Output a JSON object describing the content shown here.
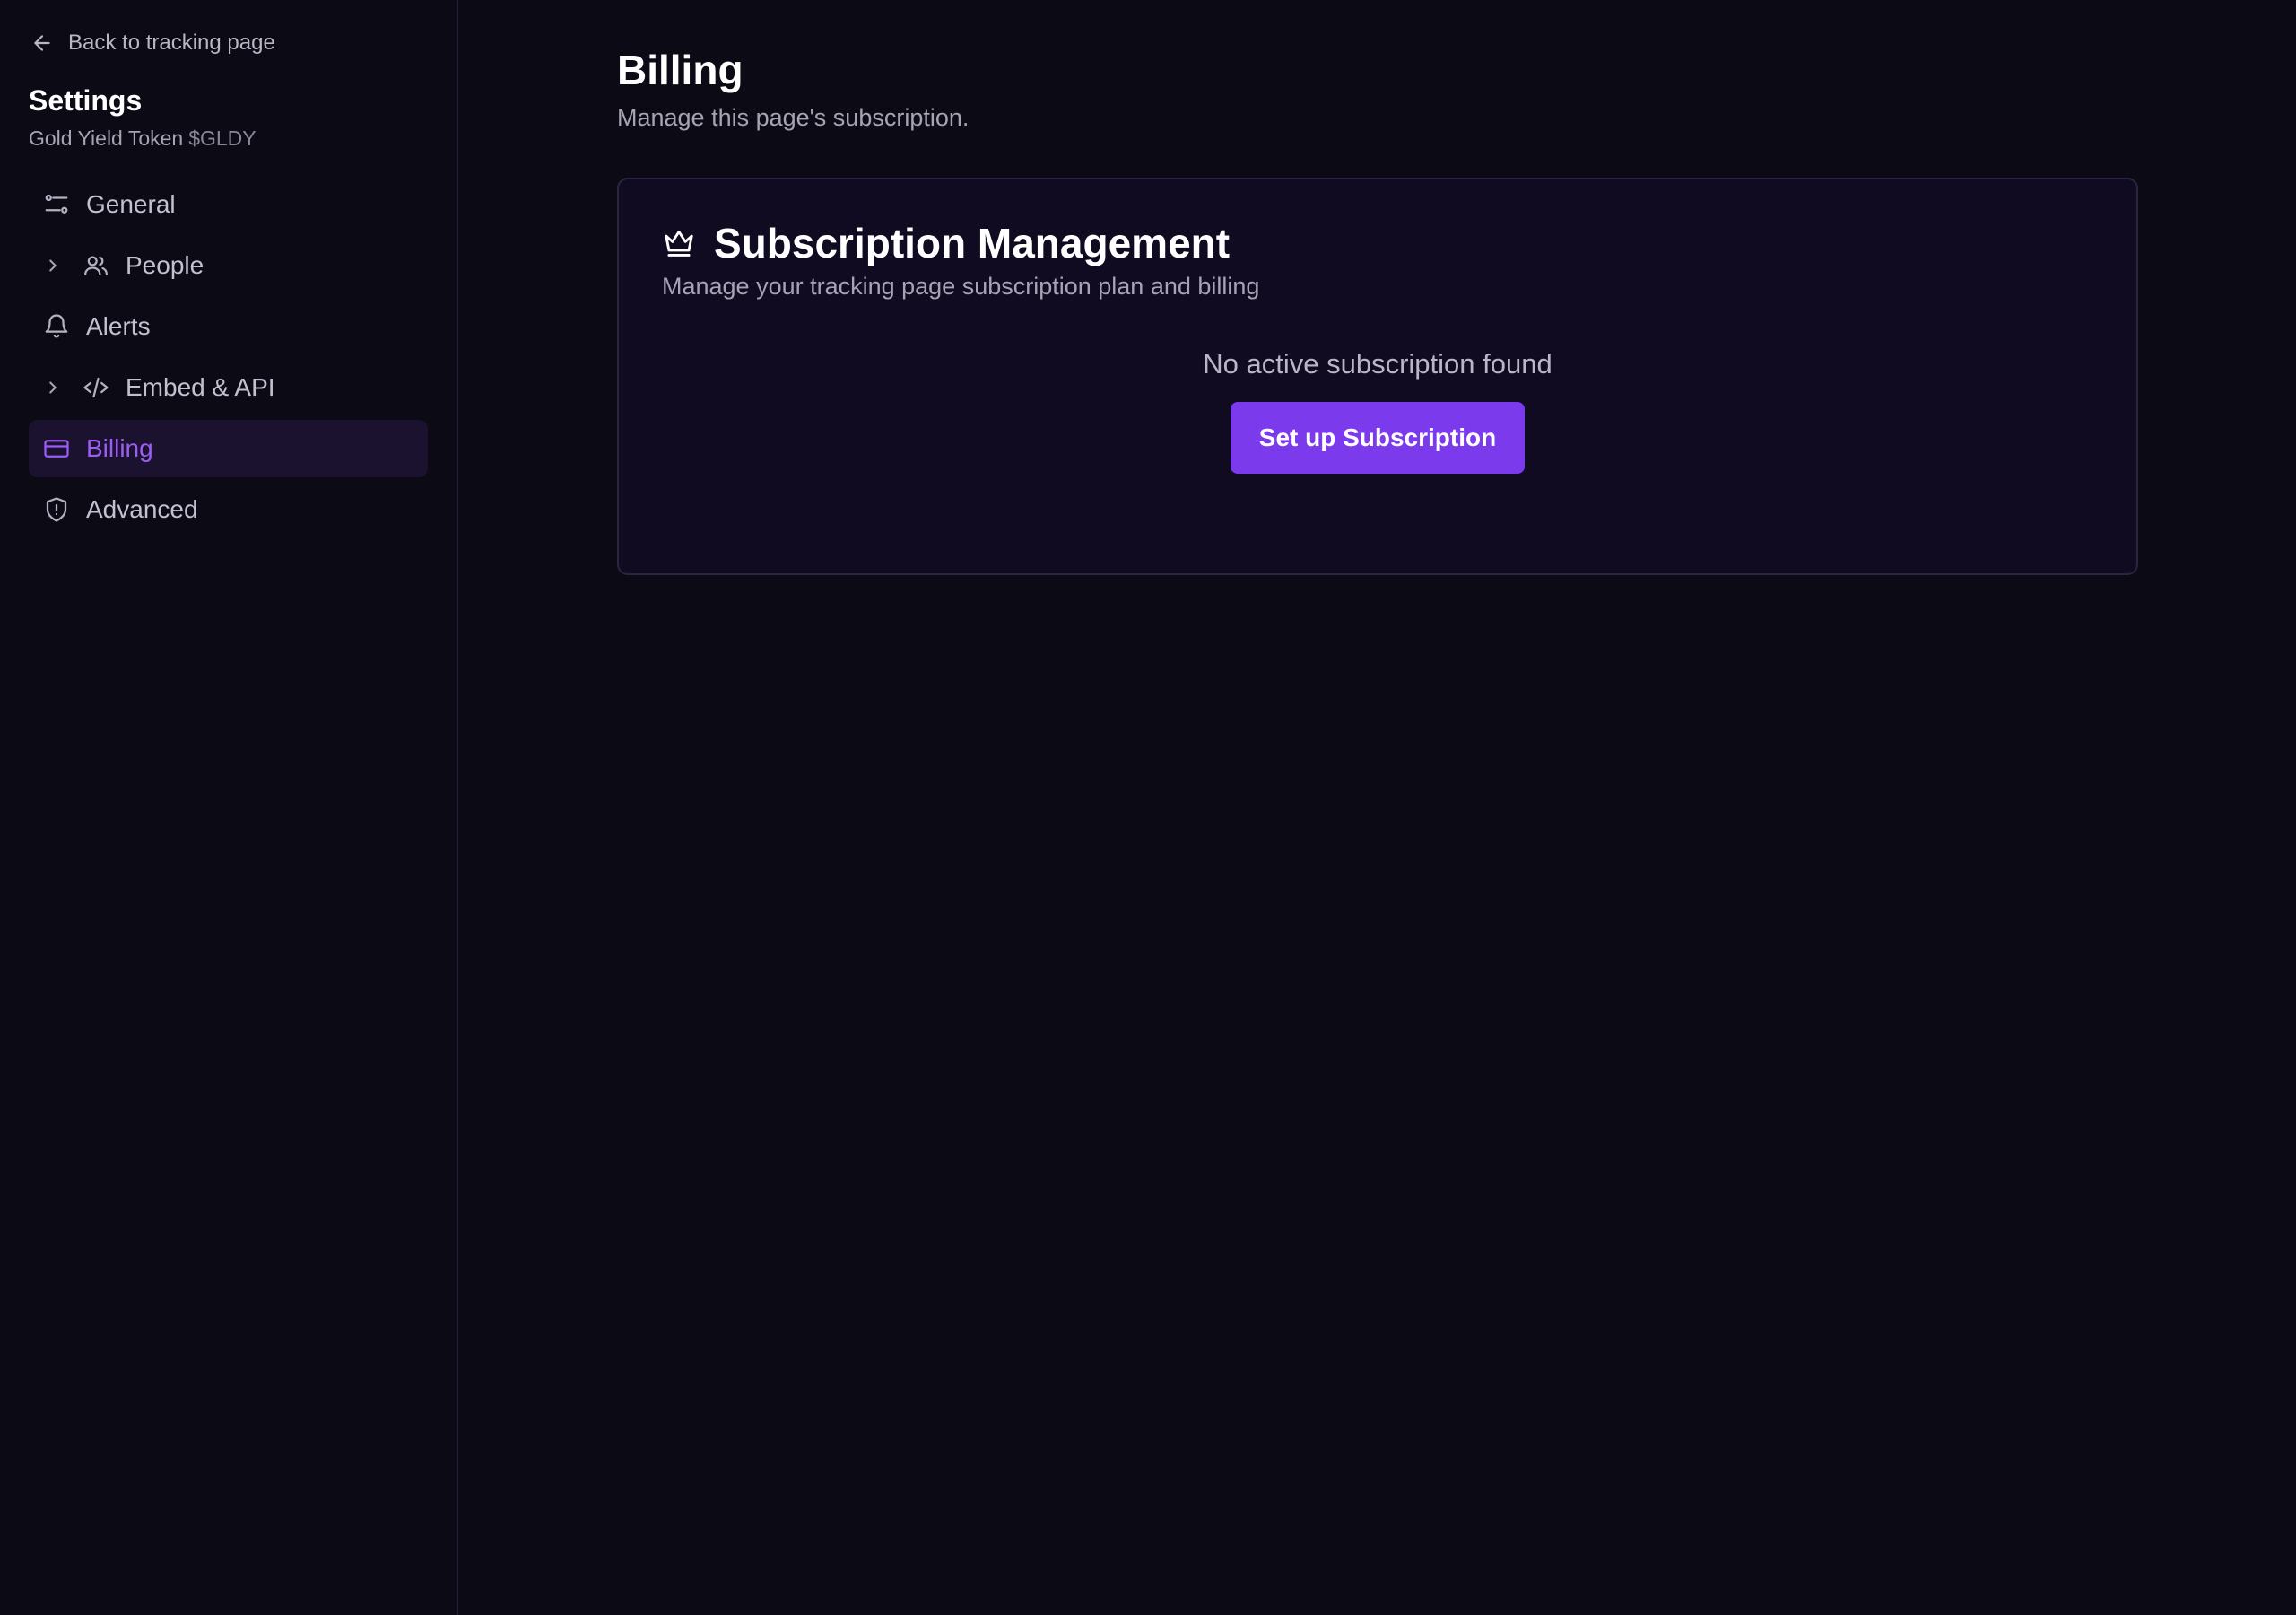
{
  "sidebar": {
    "back_label": "Back to tracking page",
    "title": "Settings",
    "project_name": "Gold Yield Token",
    "project_ticker": "$GLDY",
    "items": [
      {
        "label": "General",
        "icon": "sliders-icon",
        "expandable": false,
        "active": false
      },
      {
        "label": "People",
        "icon": "users-icon",
        "expandable": true,
        "active": false
      },
      {
        "label": "Alerts",
        "icon": "bell-icon",
        "expandable": false,
        "active": false
      },
      {
        "label": "Embed & API",
        "icon": "code-icon",
        "expandable": true,
        "active": false
      },
      {
        "label": "Billing",
        "icon": "credit-card-icon",
        "expandable": false,
        "active": true
      },
      {
        "label": "Advanced",
        "icon": "shield-alert-icon",
        "expandable": false,
        "active": false
      }
    ]
  },
  "main": {
    "title": "Billing",
    "subtitle": "Manage this page's subscription.",
    "card": {
      "icon": "crown-icon",
      "title": "Subscription Management",
      "subtitle": "Manage your tracking page subscription plan and billing",
      "empty_text": "No active subscription found",
      "button_label": "Set up Subscription"
    }
  },
  "colors": {
    "background": "#0c0a14",
    "card_background": "#110b21",
    "accent": "#7c3aed",
    "active_text": "#9d5cf5",
    "active_bg": "#1b1230"
  }
}
